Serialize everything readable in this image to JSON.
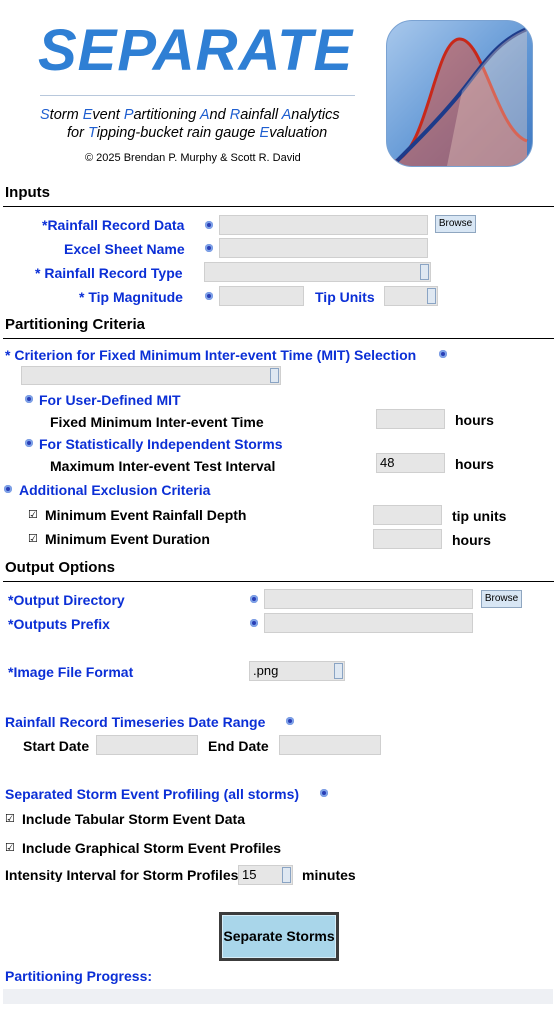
{
  "header": {
    "app_name": "SEPARATE",
    "subtitle_line1": [
      {
        "cap": "S",
        "rest": "torm "
      },
      {
        "cap": "E",
        "rest": "vent "
      },
      {
        "cap": "P",
        "rest": "artitioning "
      },
      {
        "cap": "A",
        "rest": "nd "
      },
      {
        "cap": "R",
        "rest": "ainfall "
      },
      {
        "cap": "A",
        "rest": "nalytics"
      }
    ],
    "subtitle_line2": [
      {
        "cap": "",
        "rest": "for "
      },
      {
        "cap": "T",
        "rest": "ipping-bucket rain gauge "
      },
      {
        "cap": "E",
        "rest": "valuation"
      }
    ],
    "copyright": "© 2025 Brendan P. Murphy & Scott R. David",
    "icon": "bell-curve-app-icon"
  },
  "inputs": {
    "heading": "Inputs",
    "rainfall_record_data_label": "*Rainfall Record Data",
    "rainfall_record_data_value": "",
    "browse_label": "Browse",
    "excel_sheet_label": "Excel Sheet Name",
    "excel_sheet_value": "",
    "record_type_label": "* Rainfall Record Type",
    "record_type_value": "",
    "tip_magnitude_label": "* Tip Magnitude",
    "tip_magnitude_value": "",
    "tip_units_label": "Tip Units",
    "tip_units_value": ""
  },
  "partitioning": {
    "heading": "Partitioning Criteria",
    "mit_criterion_label": "* Criterion for Fixed Minimum Inter-event Time (MIT) Selection",
    "mit_criterion_value": "",
    "user_defined_label": "For User-Defined MIT",
    "fixed_mit_label": "Fixed Minimum Inter-event Time",
    "fixed_mit_value": "",
    "fixed_mit_unit": "hours",
    "stat_independent_label": "For Statistically Independent Storms",
    "max_test_interval_label": "Maximum Inter-event Test Interval",
    "max_test_interval_value": "48",
    "max_test_interval_unit": "hours",
    "additional_exclusion_label": "Additional Exclusion Criteria",
    "min_depth_label": "Minimum Event Rainfall Depth",
    "min_depth_checked": true,
    "min_depth_value": "",
    "min_depth_unit": "tip units",
    "min_duration_label": "Minimum Event Duration",
    "min_duration_checked": true,
    "min_duration_value": "",
    "min_duration_unit": "hours"
  },
  "output": {
    "heading": "Output Options",
    "output_dir_label": "*Output Directory",
    "output_dir_value": "",
    "browse_label": "Browse",
    "outputs_prefix_label": "*Outputs Prefix",
    "outputs_prefix_value": "",
    "image_format_label": "*Image File Format",
    "image_format_value": ".png",
    "date_range_label": "Rainfall Record Timeseries Date Range",
    "start_date_label": "Start Date",
    "start_date_value": "",
    "end_date_label": "End Date",
    "end_date_value": "",
    "profiling_label": "Separated Storm Event Profiling (all storms)",
    "tabular_label": "Include Tabular Storm Event Data",
    "tabular_checked": true,
    "graphical_label": "Include Graphical Storm Event Profiles",
    "graphical_checked": true,
    "intensity_label": "Intensity Interval for Storm Profiles",
    "intensity_value": "15",
    "intensity_unit": "minutes"
  },
  "run": {
    "button_label": "Separate Storms",
    "progress_label": "Partitioning Progress:",
    "progress_fraction": 0
  },
  "colors": {
    "accent_blue": "#0b2fd6",
    "logo_blue": "#2f7fd4",
    "button_bg": "#a9d6ea"
  },
  "check_glyph": "☑"
}
